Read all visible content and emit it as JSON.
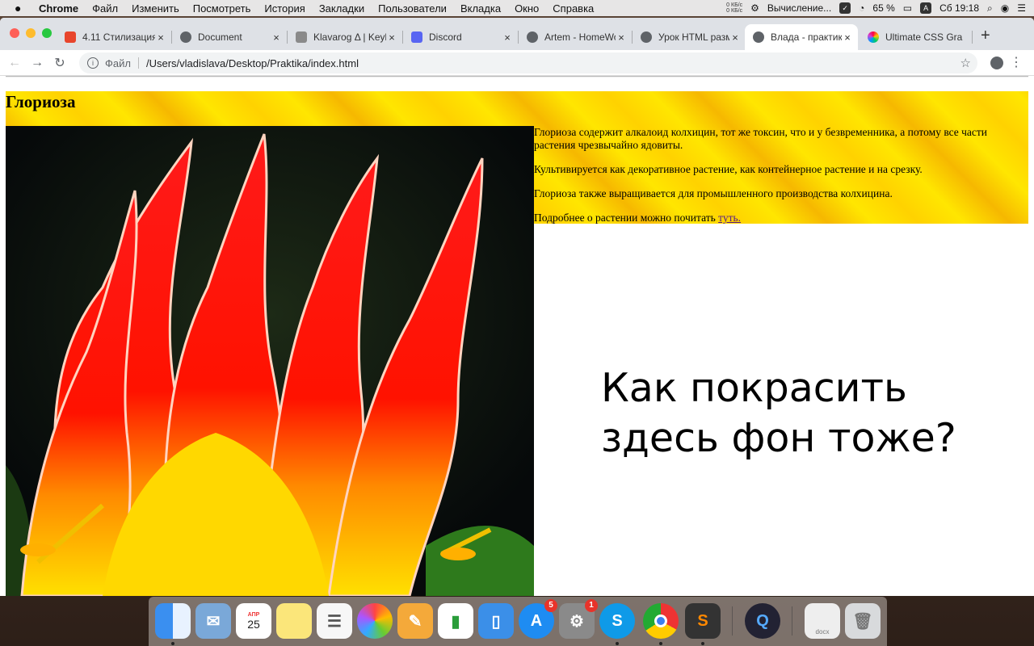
{
  "menubar": {
    "app_name": "Chrome",
    "items": [
      "Файл",
      "Изменить",
      "Посмотреть",
      "История",
      "Закладки",
      "Пользователи",
      "Вкладка",
      "Окно",
      "Справка"
    ],
    "net_up": "0 КБ/с",
    "net_down": "0 КБ/с",
    "status_text": "Вычисление...",
    "battery": "65 %",
    "input_source": "A",
    "clock": "Сб 19:18"
  },
  "tabs": [
    {
      "title": "4.11 Стилизация",
      "color": "#e8452c",
      "active": false
    },
    {
      "title": "Document",
      "color": "#5f6368",
      "active": false
    },
    {
      "title": "Klavarog Δ | Keyb",
      "color": "#8a8a8a",
      "active": false
    },
    {
      "title": "Discord",
      "color": "#5865f2",
      "active": false
    },
    {
      "title": "Artem - HomeWo",
      "color": "#5f6368",
      "active": false
    },
    {
      "title": "Урок HTML разм",
      "color": "#5f6368",
      "active": false
    },
    {
      "title": "Влада - практик",
      "color": "#5f6368",
      "active": true
    },
    {
      "title": "Ultimate CSS Gra",
      "color": "#c04ad8",
      "active": false
    }
  ],
  "omnibox": {
    "scheme_label": "Файл",
    "url": "/Users/vladislava/Desktop/Praktika/index.html"
  },
  "page": {
    "heading": "Глориоза",
    "paragraphs": [
      "Глориоза содержит алкалоид колхицин, тот же токсин, что и у безвременника, а потому все части растения чрезвычайно ядовиты.",
      "Культивируется как декоративное растение, как контейнерное растение и на срезку.",
      "Глориоза также выращивается для промышленного производства колхицина."
    ],
    "more_text": "Подробнее о растении можно почитать",
    "more_link": "туть.",
    "question": "Как покрасить здесь фон тоже?"
  },
  "dock": {
    "calendar_month": "АПР",
    "calendar_day": "25",
    "appstore_badge": "5",
    "prefs_badge": "1",
    "file_label": "docx"
  },
  "colors": {
    "banner_yellow": "#ffd200",
    "banner_light": "#ffe600",
    "link": "#551a8b"
  }
}
